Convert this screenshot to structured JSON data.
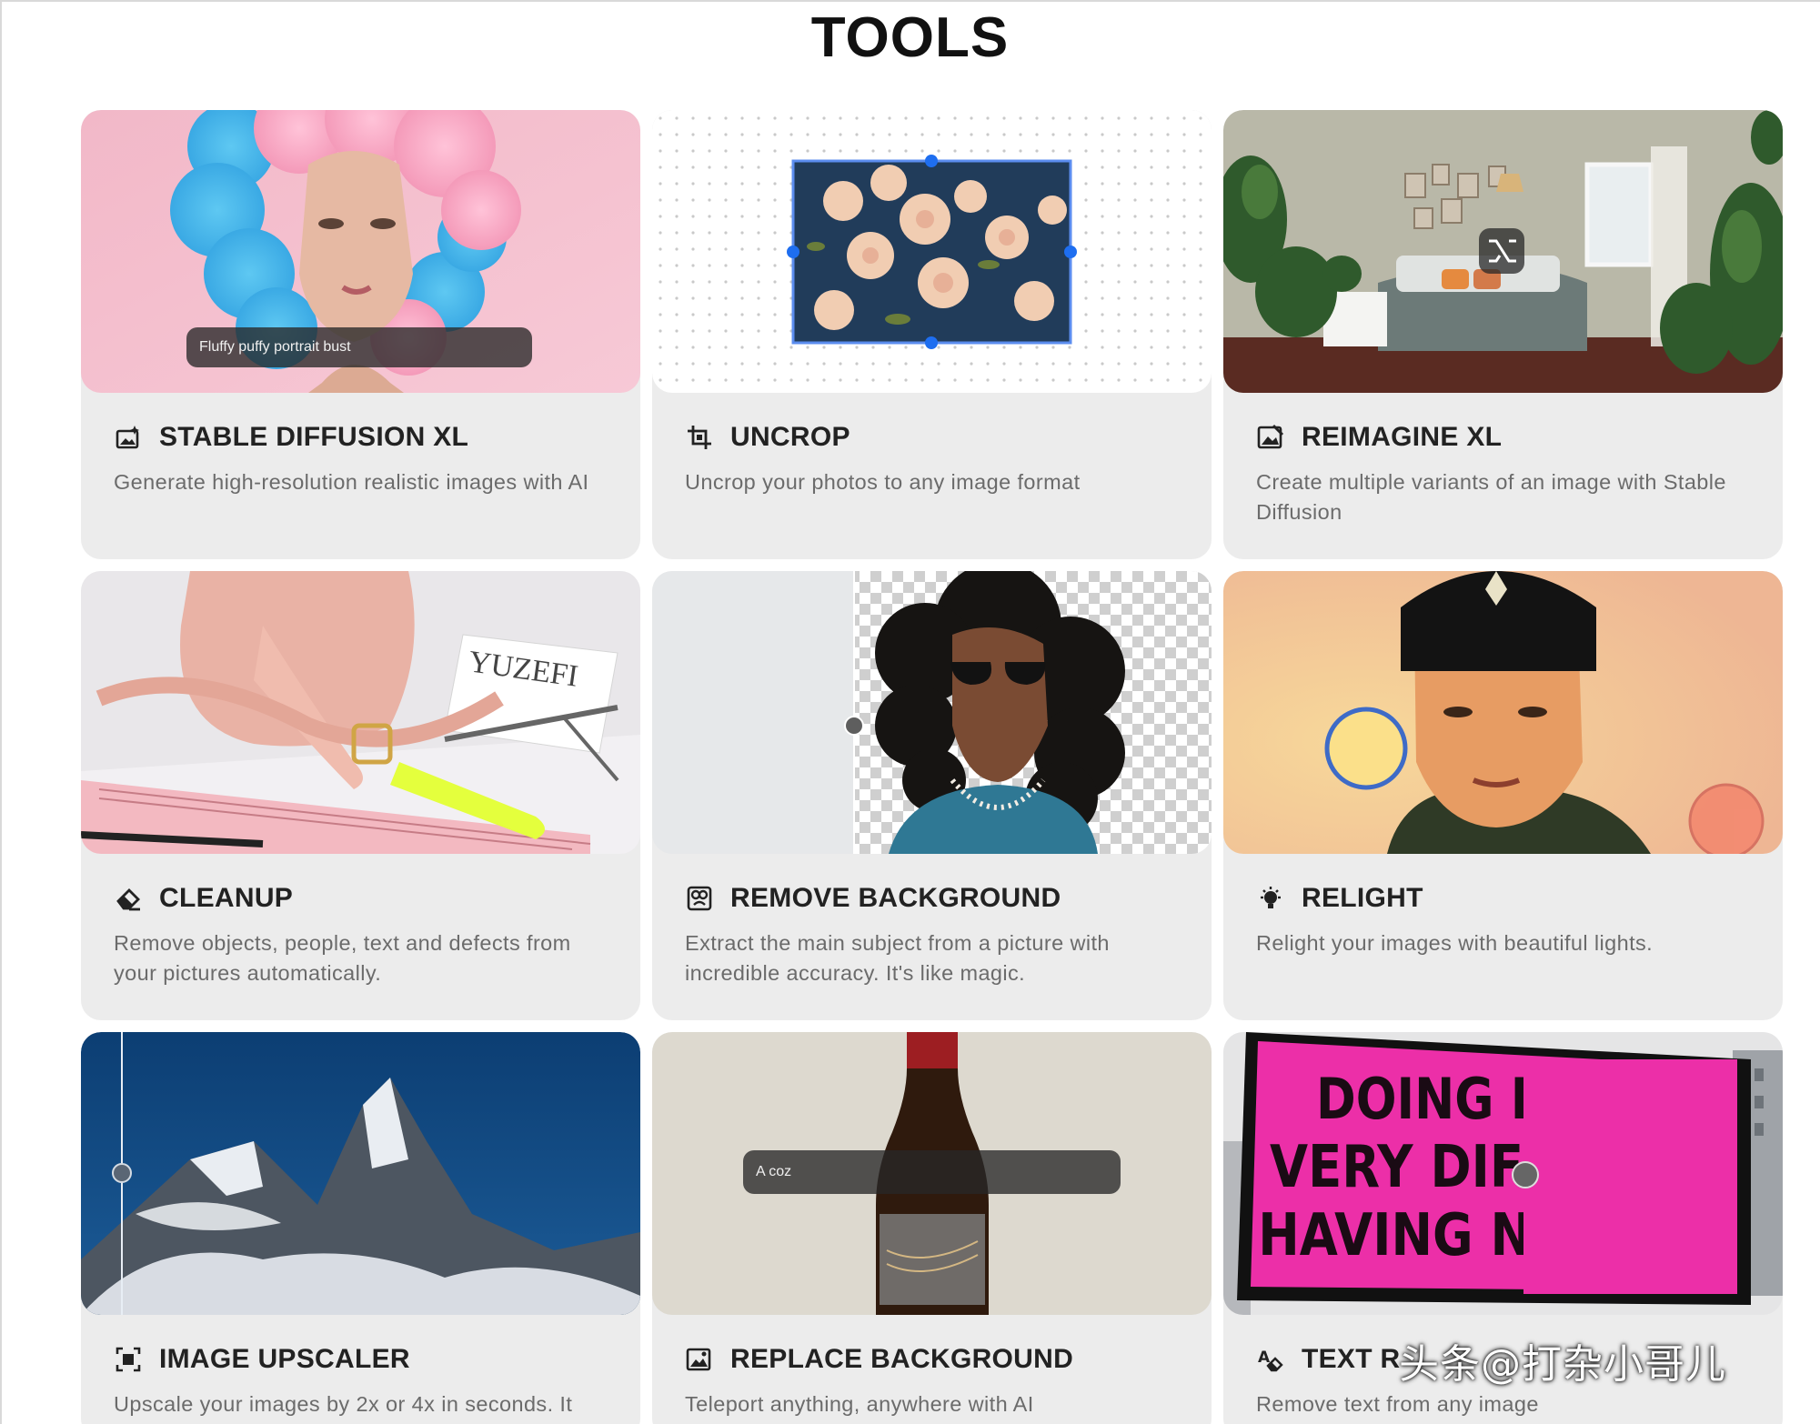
{
  "page": {
    "title": "TOOLS"
  },
  "tools": [
    {
      "title": "STABLE DIFFUSION XL",
      "description": "Generate high-resolution realistic images with AI",
      "icon": "image-sparkle-icon",
      "caption": "Fluffy puffy portrait bust"
    },
    {
      "title": "UNCROP",
      "description": "Uncrop your photos to any image format",
      "icon": "crop-icon"
    },
    {
      "title": "REIMAGINE XL",
      "description": "Create multiple variants of an image with Stable Diffusion",
      "icon": "image-variant-icon"
    },
    {
      "title": "CLEANUP",
      "description": "Remove objects, people, text and defects from your pictures automatically.",
      "icon": "eraser-icon"
    },
    {
      "title": "REMOVE BACKGROUND",
      "description": "Extract the main subject from a picture with incredible accuracy. It's like magic.",
      "icon": "subject-cutout-icon"
    },
    {
      "title": "RELIGHT",
      "description": "Relight your images with beautiful lights.",
      "icon": "light-bulb-icon"
    },
    {
      "title": "IMAGE UPSCALER",
      "description": "Upscale your images by 2x or 4x in seconds. It",
      "icon": "upscale-icon"
    },
    {
      "title": "REPLACE BACKGROUND",
      "description": "Teleport anything, anywhere with AI",
      "icon": "image-replace-icon",
      "caption": "A coz"
    },
    {
      "title": "TEXT R",
      "description": "Remove text from any image",
      "icon": "text-eraser-icon",
      "billboard_lines": [
        "DOING NC",
        "VERY DIFFE",
        "HAVING NOT"
      ]
    }
  ],
  "watermark": "头条@打杂小哥儿"
}
